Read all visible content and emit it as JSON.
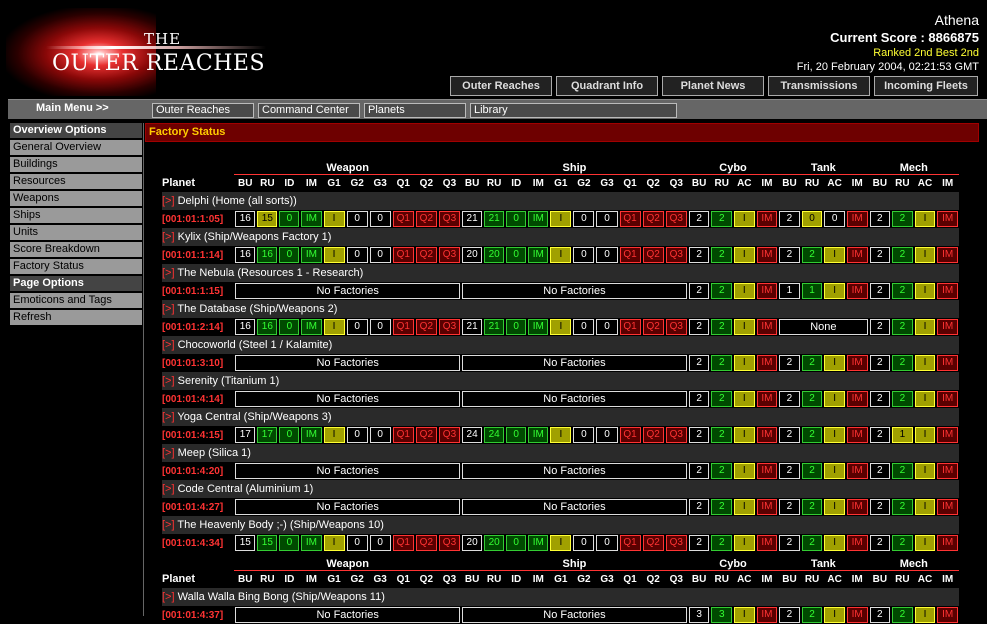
{
  "header": {
    "logo_the": "THE",
    "logo_name": "OUTER REACHES",
    "username": "Athena",
    "score": "Current Score : 8866875",
    "rank": "Ranked 2nd Best 2nd",
    "datetime": "Fri, 20 February 2004, 02:21:53 GMT",
    "nav": [
      "Outer Reaches",
      "Quadrant Info",
      "Planet News",
      "Transmissions",
      "Incoming Fleets"
    ]
  },
  "mainbar": {
    "label": "Main Menu >>",
    "items": [
      "Outer Reaches",
      "Command Center",
      "Planets",
      "Library"
    ]
  },
  "sidebar": {
    "overview_heading": "Overview Options",
    "overview_items": [
      "General Overview",
      "Buildings",
      "Resources",
      "Weapons",
      "Ships",
      "Units",
      "Score Breakdown",
      "Factory Status"
    ],
    "page_heading": "Page Options",
    "page_items": [
      "Emoticons and Tags",
      "Refresh"
    ]
  },
  "page_title": "Factory Status",
  "groups": [
    "Weapon",
    "Ship",
    "Cybo",
    "Tank",
    "Mech"
  ],
  "planet_col": "Planet",
  "col_headers": [
    "BU",
    "RU",
    "ID",
    "IM",
    "G1",
    "G2",
    "G3",
    "Q1",
    "Q2",
    "Q3",
    "BU",
    "RU",
    "ID",
    "IM",
    "G1",
    "G2",
    "G3",
    "Q1",
    "Q2",
    "Q3",
    "BU",
    "RU",
    "AC",
    "IM",
    "BU",
    "RU",
    "AC",
    "IM",
    "BU",
    "RU",
    "AC",
    "IM"
  ],
  "no_factories": "No Factories",
  "none_label": "None",
  "expand_marker": "[>]",
  "colors": {
    "accent": "#ff3333",
    "title_bg": "#6e0000",
    "title_text": "#ffcc00",
    "green": "#33ff33",
    "yellow": "#ffff33"
  },
  "planets": [
    {
      "name": "Delphi (Home (all sorts))",
      "coord": "[001:01:1:05]",
      "weapon": [
        "16",
        "15",
        "0",
        "IM",
        "I",
        "0",
        "0",
        "Q1",
        "Q2",
        "Q3"
      ],
      "ship": [
        "21",
        "21",
        "0",
        "IM",
        "I",
        "0",
        "0",
        "Q1",
        "Q2",
        "Q3"
      ],
      "cybo": [
        "2",
        "2",
        "I",
        "IM"
      ],
      "tank": [
        "2",
        "0",
        "0",
        "IM"
      ],
      "mech": [
        "2",
        "2",
        "I",
        "IM"
      ]
    },
    {
      "name": "Kylix (Ship/Weapons Factory 1)",
      "coord": "[001:01:1:14]",
      "weapon": [
        "16",
        "16",
        "0",
        "IM",
        "I",
        "0",
        "0",
        "Q1",
        "Q2",
        "Q3"
      ],
      "ship": [
        "20",
        "20",
        "0",
        "IM",
        "I",
        "0",
        "0",
        "Q1",
        "Q2",
        "Q3"
      ],
      "cybo": [
        "2",
        "2",
        "I",
        "IM"
      ],
      "tank": [
        "2",
        "2",
        "I",
        "IM"
      ],
      "mech": [
        "2",
        "2",
        "I",
        "IM"
      ]
    },
    {
      "name": "The Nebula (Resources 1 - Research)",
      "coord": "[001:01:1:15]",
      "weapon": null,
      "ship": null,
      "cybo": [
        "2",
        "2",
        "I",
        "IM"
      ],
      "tank": [
        "1",
        "1",
        "I",
        "IM"
      ],
      "mech": [
        "2",
        "2",
        "I",
        "IM"
      ]
    },
    {
      "name": "The Database (Ship/Weapons 2)",
      "coord": "[001:01:2:14]",
      "weapon": [
        "16",
        "16",
        "0",
        "IM",
        "I",
        "0",
        "0",
        "Q1",
        "Q2",
        "Q3"
      ],
      "ship": [
        "21",
        "21",
        "0",
        "IM",
        "I",
        "0",
        "0",
        "Q1",
        "Q2",
        "Q3"
      ],
      "cybo": [
        "2",
        "2",
        "I",
        "IM"
      ],
      "tank": null,
      "mech": [
        "2",
        "2",
        "I",
        "IM"
      ]
    },
    {
      "name": "Chocoworld (Steel 1 / Kalamite)",
      "coord": "[001:01:3:10]",
      "weapon": null,
      "ship": null,
      "cybo": [
        "2",
        "2",
        "I",
        "IM"
      ],
      "tank": [
        "2",
        "2",
        "I",
        "IM"
      ],
      "mech": [
        "2",
        "2",
        "I",
        "IM"
      ]
    },
    {
      "name": "Serenity (Titanium 1)",
      "coord": "[001:01:4:14]",
      "weapon": null,
      "ship": null,
      "cybo": [
        "2",
        "2",
        "I",
        "IM"
      ],
      "tank": [
        "2",
        "2",
        "I",
        "IM"
      ],
      "mech": [
        "2",
        "2",
        "I",
        "IM"
      ]
    },
    {
      "name": "Yoga Central (Ship/Weapons 3)",
      "coord": "[001:01:4:15]",
      "weapon": [
        "17",
        "17",
        "0",
        "IM",
        "I",
        "0",
        "0",
        "Q1",
        "Q2",
        "Q3"
      ],
      "ship": [
        "24",
        "24",
        "0",
        "IM",
        "I",
        "0",
        "0",
        "Q1",
        "Q2",
        "Q3"
      ],
      "cybo": [
        "2",
        "2",
        "I",
        "IM"
      ],
      "tank": [
        "2",
        "2",
        "I",
        "IM"
      ],
      "mech": [
        "2",
        "1",
        "I",
        "IM"
      ]
    },
    {
      "name": "Meep (Silica 1)",
      "coord": "[001:01:4:20]",
      "weapon": null,
      "ship": null,
      "cybo": [
        "2",
        "2",
        "I",
        "IM"
      ],
      "tank": [
        "2",
        "2",
        "I",
        "IM"
      ],
      "mech": [
        "2",
        "2",
        "I",
        "IM"
      ]
    },
    {
      "name": "Code Central (Aluminium 1)",
      "coord": "[001:01:4:27]",
      "weapon": null,
      "ship": null,
      "cybo": [
        "2",
        "2",
        "I",
        "IM"
      ],
      "tank": [
        "2",
        "2",
        "I",
        "IM"
      ],
      "mech": [
        "2",
        "2",
        "I",
        "IM"
      ]
    },
    {
      "name": "The Heavenly Body ;-) (Ship/Weapons 10)",
      "coord": "[001:01:4:34]",
      "weapon": [
        "15",
        "15",
        "0",
        "IM",
        "I",
        "0",
        "0",
        "Q1",
        "Q2",
        "Q3"
      ],
      "ship": [
        "20",
        "20",
        "0",
        "IM",
        "I",
        "0",
        "0",
        "Q1",
        "Q2",
        "Q3"
      ],
      "cybo": [
        "2",
        "2",
        "I",
        "IM"
      ],
      "tank": [
        "2",
        "2",
        "I",
        "IM"
      ],
      "mech": [
        "2",
        "2",
        "I",
        "IM"
      ]
    },
    {
      "name": "Walla Walla Bing Bong (Ship/Weapons 11)",
      "coord": "[001:01:4:37]",
      "weapon": null,
      "ship": null,
      "cybo": [
        "3",
        "3",
        "I",
        "IM"
      ],
      "tank": [
        "2",
        "2",
        "I",
        "IM"
      ],
      "mech": [
        "2",
        "2",
        "I",
        "IM"
      ]
    }
  ]
}
